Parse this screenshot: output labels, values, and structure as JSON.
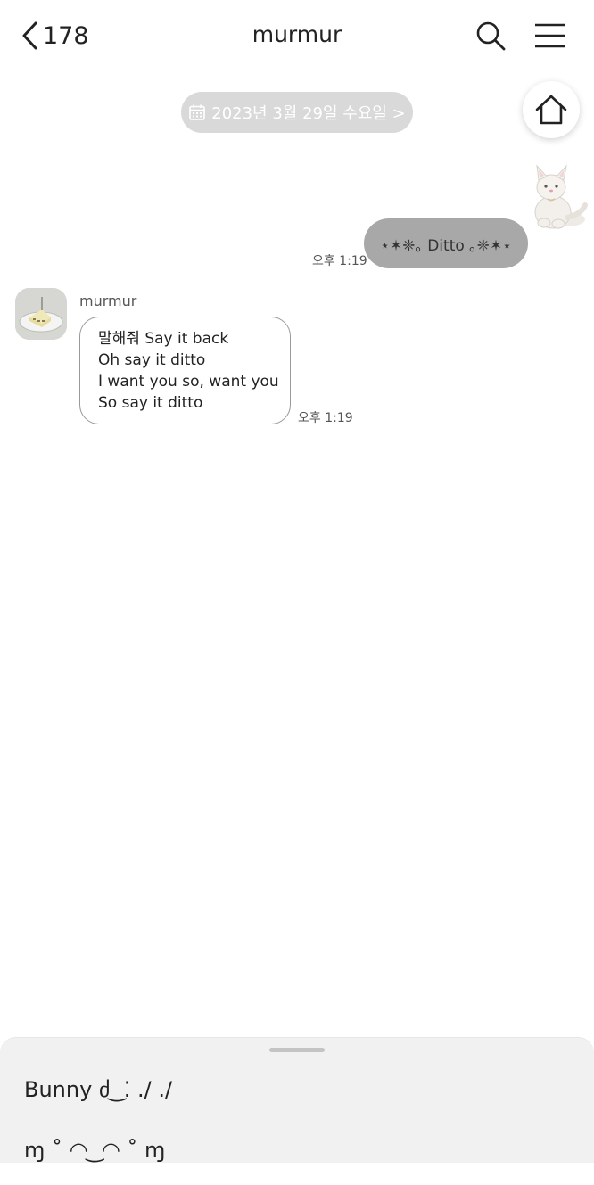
{
  "header": {
    "back_count": "178",
    "title": "murmur",
    "back_icon": "chevron-left-icon",
    "search_icon": "search-icon",
    "menu_icon": "hamburger-menu-icon"
  },
  "date_divider": {
    "icon": "calendar-icon",
    "label": "2023년 3월 29일 수요일 >"
  },
  "home_button": {
    "icon": "home-icon"
  },
  "messages": {
    "sent": {
      "sticker": "white-kitten-plush-sticker",
      "text": "⋆✶❈｡ Ditto ｡❈✶⋆",
      "time": "오후 1:19"
    },
    "received": {
      "sender": "murmur",
      "avatar": "cake-avatar",
      "lines": [
        "말해줘 Say it back",
        "Oh say it ditto",
        "I want you so, want you",
        "So say it ditto"
      ],
      "time": "오후 1:19"
    }
  },
  "bottom_sheet": {
    "items": [
      "Bunny ძ ͜ ⁚ ./ ./",
      "ɱ ˚ ◠ ͜ ◠ ˚ ɱ"
    ]
  },
  "colors": {
    "sent_bubble": "#a8a8a8",
    "date_pill": "#d9d9d9",
    "sheet_bg": "#f1f1f1"
  }
}
